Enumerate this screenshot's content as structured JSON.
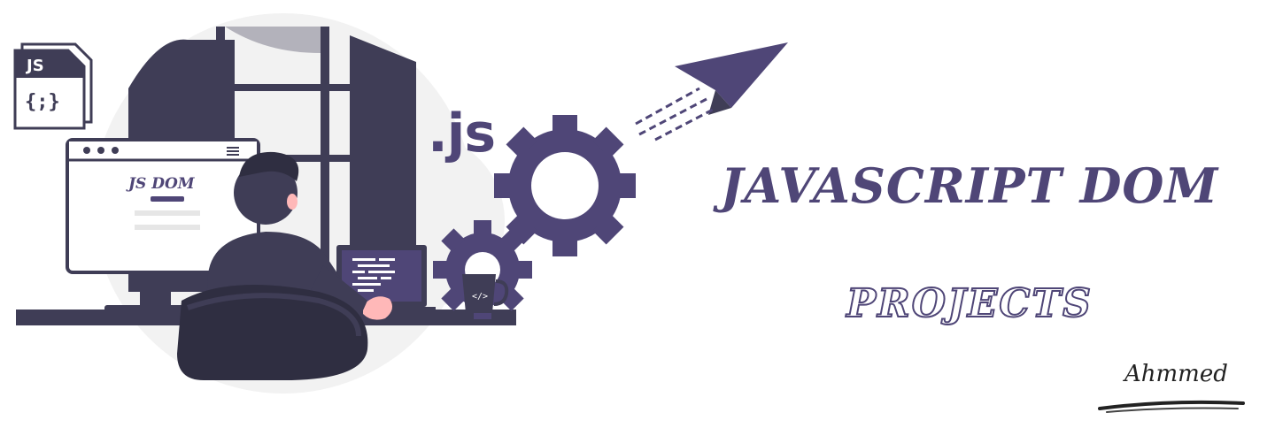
{
  "banner": {
    "title": "JAVASCRIPT DOM",
    "subtitle": "PROJECTS",
    "signature": "Ahmmed"
  },
  "illustration": {
    "file_icon_label": "JS",
    "file_icon_code": "{;}",
    "monitor_heading": "JS DOM",
    "floating_text": ".js"
  },
  "colors": {
    "accent": "#4f4677",
    "dark": "#3f3d56",
    "background": "#ffffff",
    "light_gray": "#f2f2f2",
    "skin": "#ffb8b8"
  }
}
